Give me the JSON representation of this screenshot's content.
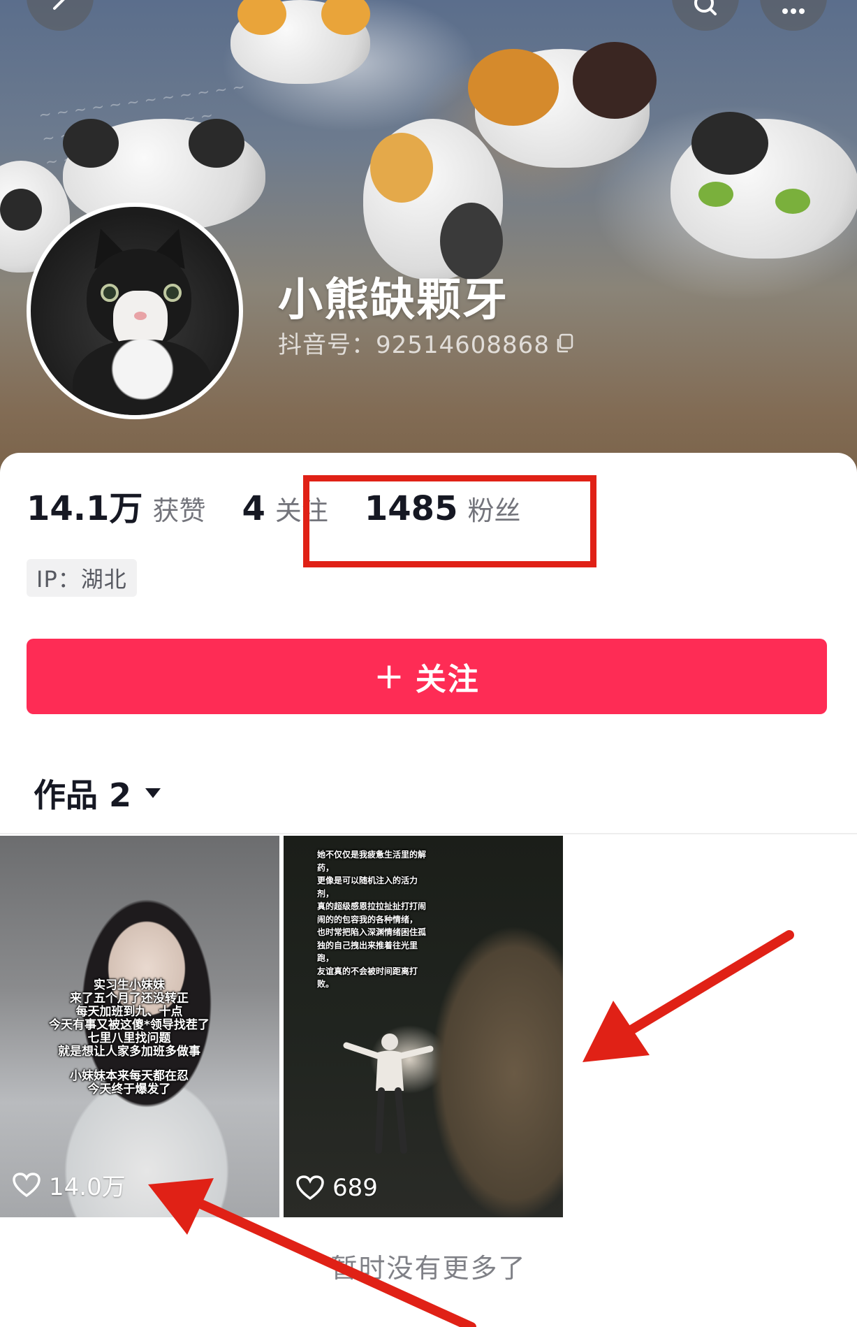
{
  "header": {
    "back_icon": "chevron-left-icon",
    "search_icon": "search-icon",
    "more_icon": "more-icon"
  },
  "profile": {
    "nickname": "小熊缺颗牙",
    "douyin_id": "抖音号：92514608868",
    "copy_icon": "copy-icon"
  },
  "stats": [
    {
      "value": "14.1万",
      "label": "获赞"
    },
    {
      "value": "4",
      "label": "关注"
    },
    {
      "value": "1485",
      "label": "粉丝"
    }
  ],
  "ip": "IP：湖北",
  "follow_button": {
    "icon": "+",
    "label": "关注"
  },
  "works_tab": {
    "label": "作品 2",
    "icon": "caret-down-icon"
  },
  "videos": [
    {
      "likes": "14.0万",
      "caption_lines": [
        "实习生小妹妹",
        "来了五个月了还没转正",
        "每天加班到九、十点",
        "今天有事又被这傻*领导找茬了",
        "七里八里找问题",
        "就是想让人家多加班多做事",
        "",
        "小妹妹本来每天都在忍",
        "今天终于爆发了"
      ]
    },
    {
      "likes": "689",
      "caption_lines": [
        "她不仅仅是我疲惫生活里的解",
        "药，",
        "更像是可以随机注入的活力",
        "剂，",
        "真的超级感恩拉拉扯扯打打闹",
        "闹的的包容我的各种情绪，",
        "也时常把陷入深渊情绪困住孤",
        "独的自己拽出来推着往光里",
        "跑，",
        "友谊真的不会被时间距离打",
        "败。"
      ]
    }
  ],
  "end_text": "暂时没有更多了",
  "colors": {
    "accent": "#fe2c55",
    "annotation": "#e02116"
  }
}
